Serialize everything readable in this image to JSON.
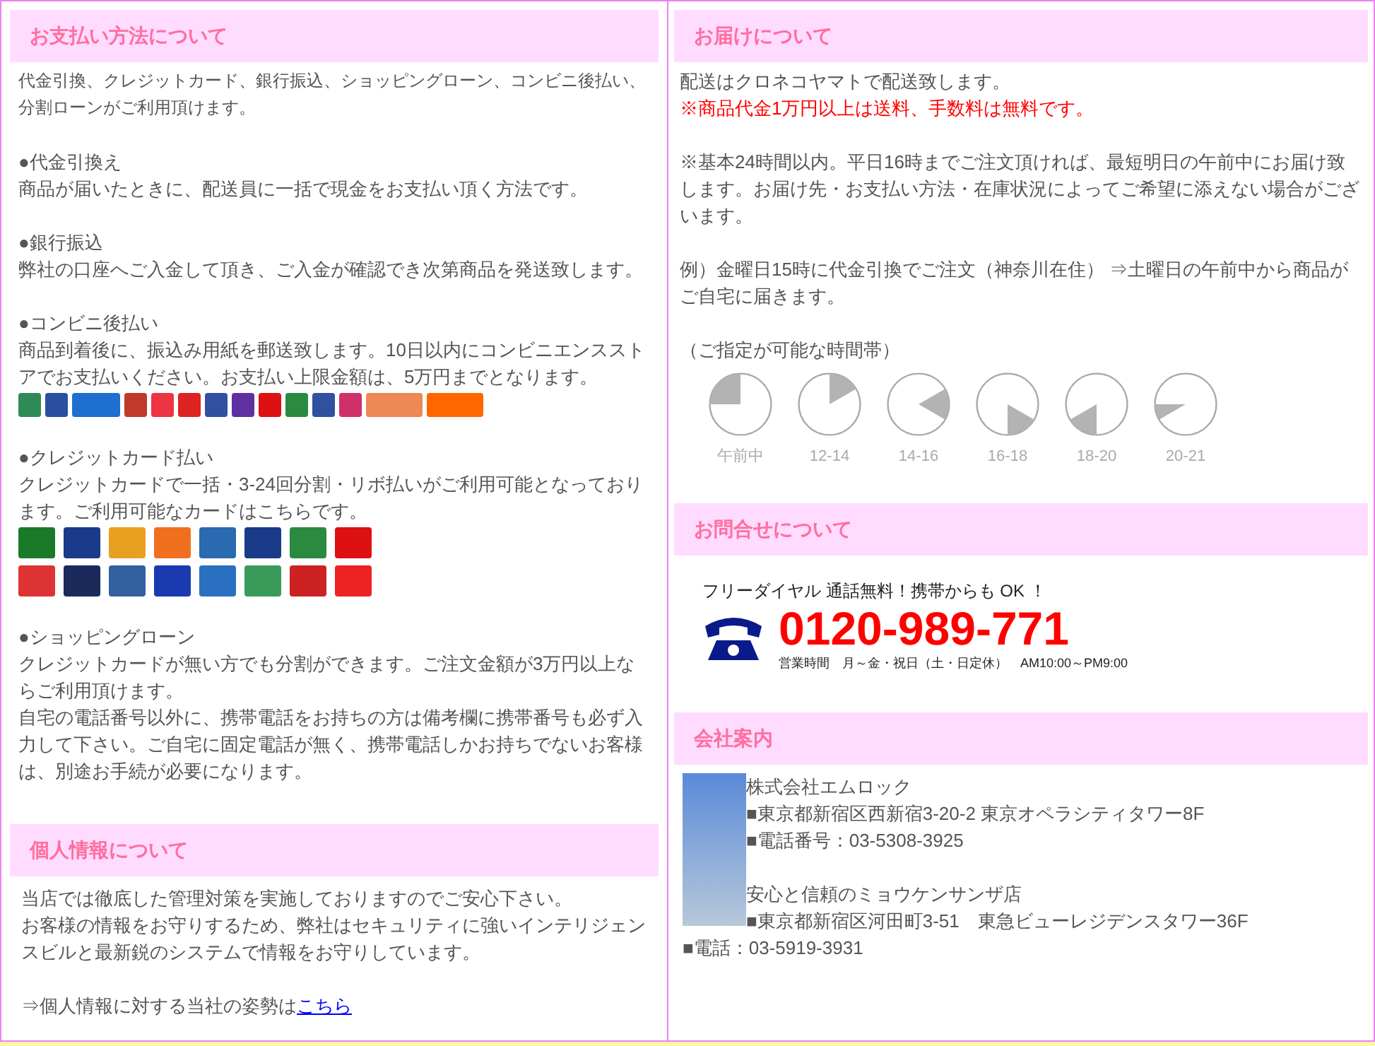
{
  "payment": {
    "title": "お支払い方法について",
    "intro": "代金引換、クレジットカード、銀行振込、ショッピングローン、コンビニ後払い、分割ローンがご利用頂けます。",
    "methods": [
      {
        "kind": "plain",
        "title": "●代金引換え",
        "paragraphs": [
          "商品が届いたときに、配送員に一括で現金をお支払い頂く方法です。"
        ]
      },
      {
        "kind": "plain",
        "title": "●銀行振込",
        "paragraphs": [
          "弊社の口座へご入金して頂き、ご入金が確認でき次第商品を発送致します。"
        ]
      },
      {
        "kind": "stores",
        "title": "●コンビニ後払い",
        "paragraphs": [
          "商品到着後に、振込み用紙を郵送致します。10日以内にコンビニエンスストアでお支払いください。お支払い上限金額は、5万円までとなります。"
        ]
      },
      {
        "kind": "cards",
        "title": "●クレジットカード払い",
        "paragraphs": [
          "クレジットカードで一括・3-24回分割・リボ払いがご利用可能となっております。ご利用可能なカードはこちらです。"
        ]
      },
      {
        "kind": "plain",
        "title": "●ショッピングローン",
        "paragraphs": [
          "クレジットカードが無い方でも分割ができます。ご注文金額が3万円以上ならご利用頂けます。",
          "自宅の電話番号以外に、携帯電話をお持ちの方は備考欄に携帯番号も必ず入力して下さい。ご自宅に固定電話が無く、携帯電話しかお持ちでないお客様は、別途お手続が必要になります。"
        ]
      }
    ]
  },
  "privacy": {
    "title": "個人情報について",
    "paragraphs": [
      "当店では徹底した管理対策を実施しておりますのでご安心下さい。",
      "お客様の情報をお守りするため、弊社はセキュリティに強いインテリジェンスビルと最新鋭のシステムで情報をお守りしています。"
    ],
    "link_prefix": "⇒個人情報に対する当社の姿勢は",
    "link": "こちら"
  },
  "delivery": {
    "title": "お届けについて",
    "carrier": "配送はクロネコヤマトで配送致します。",
    "free_shipping": "※商品代金1万円以上は送料、手数料は無料です。",
    "timing": "※基本24時間以内。平日16時までご注文頂ければ、最短明日の午前中にお届け致します。お届け先・お支払い方法・在庫状況によってご希望に添えない場合がございます。",
    "example": "例）金曜日15時に代金引換でご注文（神奈川在住） ⇒土曜日の午前中から商品がご自宅に届きます。",
    "slots_label": "（ご指定が可能な時間帯）",
    "slots": [
      "午前中",
      "12-14",
      "14-16",
      "16-18",
      "18-20",
      "20-21"
    ]
  },
  "contact": {
    "title": "お問合せについて",
    "tagline": "フリーダイヤル 通話無料！携帯からも OK ！",
    "phone": "0120-989-771",
    "hours": "営業時間　月～金・祝日（土・日定休）　AM10:00～PM9:00"
  },
  "company": {
    "title": "会社案内",
    "name": "株式会社エムロック",
    "address": "■東京都新宿区西新宿3-20-2 東京オペラシティタワー8F",
    "phone": "■電話番号：03-5308-3925",
    "shop_name": "安心と信頼のミョウケンサンザ店",
    "shop_address": "■東京都新宿区河田町3-51　東急ビューレジデンスタワー36F",
    "shop_phone": "■電話：03-5919-3931"
  }
}
